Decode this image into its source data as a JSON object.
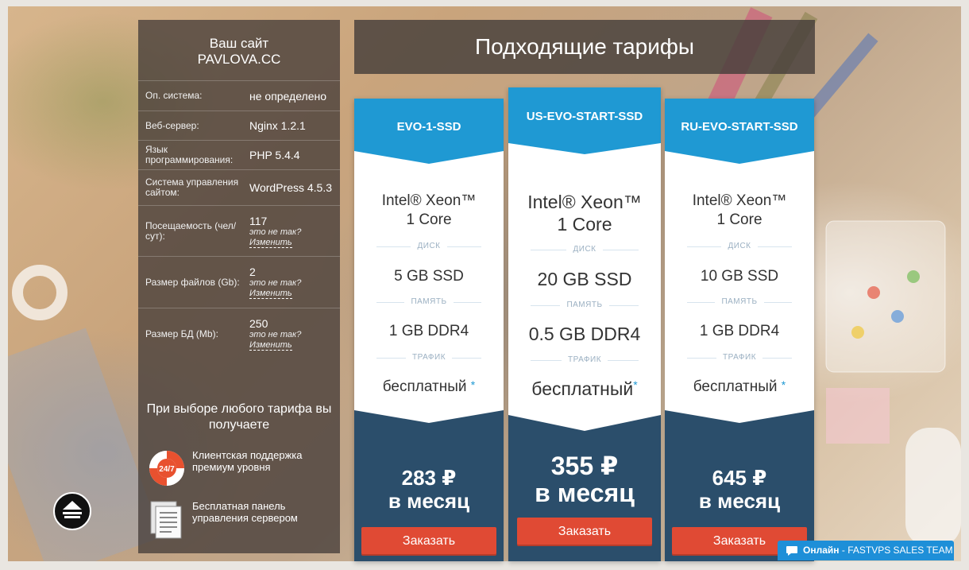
{
  "header": {
    "title": "Подходящие тарифы"
  },
  "site": {
    "label": "Ваш сайт",
    "domain": "PAVLOVA.CC"
  },
  "info": [
    {
      "label": "Оп. система:",
      "value": "не определено"
    },
    {
      "label": "Веб-сервер:",
      "value": "Nginx 1.2.1"
    },
    {
      "label": "Язык программирования:",
      "value": "PHP 5.4.4"
    },
    {
      "label": "Система управления сайтом:",
      "value": "WordPress 4.5.3"
    },
    {
      "label": "Посещаемость (чел/сут):",
      "value": "117",
      "note": "это не так?",
      "action": "Изменить"
    },
    {
      "label": "Размер файлов (Gb):",
      "value": "2",
      "note": "это не так?",
      "action": "Изменить"
    },
    {
      "label": "Размер БД (Mb):",
      "value": "250",
      "note": "это не так?",
      "action": "Изменить"
    }
  ],
  "bonus": {
    "title": "При выборе любого тарифа вы получаете",
    "items": [
      {
        "icon": "lifebuoy-icon",
        "badge": "24/7",
        "text": "Клиентская поддержка премиум уровня"
      },
      {
        "icon": "document-icon",
        "text": "Бесплатная панель управления сервером"
      }
    ]
  },
  "spec_labels": {
    "disk": "ДИСК",
    "memory": "ПАМЯТЬ",
    "traffic": "ТРАФИК"
  },
  "plans": [
    {
      "name": "EVO-1-SSD",
      "cpu_line1": "Intel® Xeon™",
      "cpu_line2": "1 Core",
      "disk": "5 GB SSD",
      "memory": "1 GB DDR4",
      "traffic": "бесплатный",
      "star": "*",
      "price": "283 ₽",
      "period": "в месяц",
      "button": "Заказать"
    },
    {
      "name": "US-EVO-START-SSD",
      "cpu_line1": "Intel® Xeon™",
      "cpu_line2": "1 Core",
      "disk": "20 GB SSD",
      "memory": "0.5 GB DDR4",
      "traffic": "бесплатный",
      "star": "*",
      "price": "355 ₽",
      "period": "в месяц",
      "button": "Заказать",
      "featured": true
    },
    {
      "name": "RU-EVO-START-SSD",
      "cpu_line1": "Intel® Xeon™",
      "cpu_line2": "1 Core",
      "disk": "10 GB SSD",
      "memory": "1 GB DDR4",
      "traffic": "бесплатный",
      "star": "*",
      "price": "645 ₽",
      "period": "в месяц",
      "button": "Заказать"
    }
  ],
  "chat": {
    "status": "Онлайн",
    "team": "- FASTVPS SALES TEAM",
    "icon": "chat-bubble-icon"
  },
  "colors": {
    "accent": "#1f99d3",
    "footer": "#2b4e6b",
    "button": "#e04a34",
    "chat": "#1e8fd8"
  }
}
